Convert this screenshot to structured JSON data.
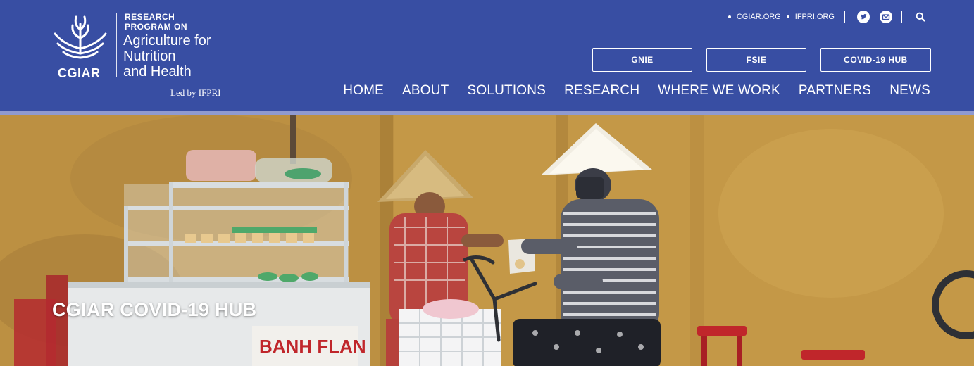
{
  "logo": {
    "org": "CGIAR",
    "research_program_line1": "RESEARCH",
    "research_program_line2": "PROGRAM ON",
    "title_line1": "Agriculture for",
    "title_line2": "Nutrition",
    "title_line3": "and Health",
    "led_by": "Led by IFPRI"
  },
  "utility": {
    "links": [
      {
        "label": "CGIAR.ORG"
      },
      {
        "label": "IFPRI.ORG"
      }
    ],
    "icons": [
      "twitter-icon",
      "email-icon",
      "search-icon"
    ]
  },
  "buttons": {
    "gnie": "GNIE",
    "fsie": "FSIE",
    "covid": "COVID-19 HUB"
  },
  "nav": {
    "items": [
      {
        "label": "HOME"
      },
      {
        "label": "ABOUT"
      },
      {
        "label": "SOLUTIONS"
      },
      {
        "label": "RESEARCH"
      },
      {
        "label": "WHERE WE WORK"
      },
      {
        "label": "PARTNERS"
      },
      {
        "label": "NEWS"
      }
    ]
  },
  "hero": {
    "title": "CGIAR COVID-19 HUB",
    "cart_sign": "BANH FLAN"
  },
  "colors": {
    "header_bg": "#384ea3",
    "header_stripe": "#8f9ad0",
    "wall": "#c89c4a"
  }
}
